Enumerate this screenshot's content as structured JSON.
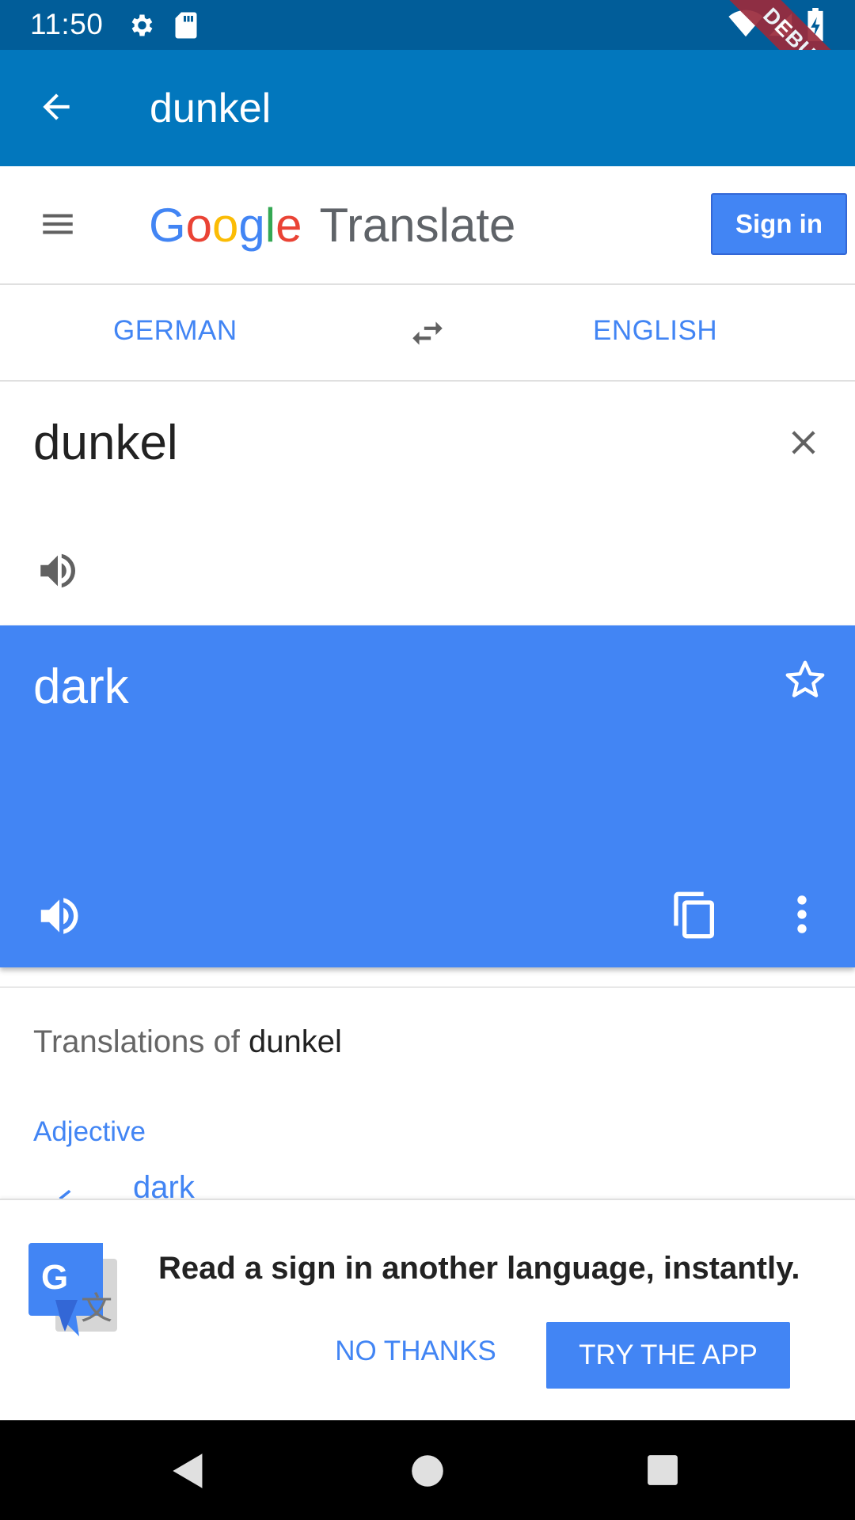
{
  "status_bar": {
    "time": "11:50"
  },
  "debug_banner": "DEBUG",
  "app_bar": {
    "title": "dunkel"
  },
  "header": {
    "logo_google": [
      "G",
      "o",
      "o",
      "g",
      "l",
      "e"
    ],
    "logo_product": "Translate",
    "sign_in_label": "Sign in"
  },
  "languages": {
    "source": "GERMAN",
    "target": "ENGLISH"
  },
  "source": {
    "text": "dunkel"
  },
  "result": {
    "text": "dark"
  },
  "translations": {
    "heading_prefix": "Translations of",
    "heading_word": "dunkel",
    "part_of_speech": "Adjective",
    "first_word": "dark"
  },
  "promo": {
    "message": "Read a sign in another language, instantly.",
    "no_thanks_label": "NO THANKS",
    "try_app_label": "TRY THE APP"
  },
  "colors": {
    "status_bar": "#015d99",
    "app_bar": "#0277bd",
    "accent": "#4285f4",
    "debug_ribbon": "#9b2b3c"
  },
  "icons": [
    "settings-icon",
    "sd-card-icon",
    "wifi-icon",
    "signal-icon",
    "battery-icon",
    "back-arrow-icon",
    "menu-icon",
    "swap-icon",
    "clear-icon",
    "speaker-icon",
    "star-icon",
    "copy-icon",
    "more-vert-icon",
    "translate-app-icon",
    "nav-back-icon",
    "nav-home-icon",
    "nav-recents-icon"
  ]
}
